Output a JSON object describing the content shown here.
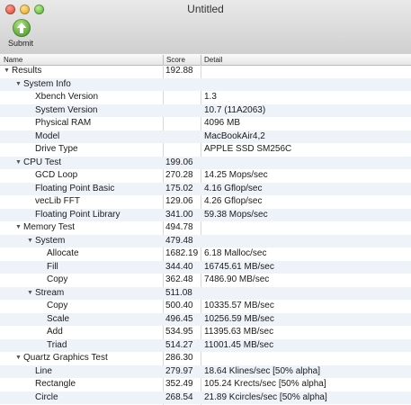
{
  "window": {
    "title": "Untitled"
  },
  "toolbar": {
    "submit_label": "Submit"
  },
  "columns": {
    "name": "Name",
    "score": "Score",
    "detail": "Detail"
  },
  "rows": [
    {
      "name": "Results",
      "score": "192.88",
      "detail": "",
      "level": 0,
      "expandable": true
    },
    {
      "name": "System Info",
      "score": "",
      "detail": "",
      "level": 1,
      "expandable": true
    },
    {
      "name": "Xbench Version",
      "score": "",
      "detail": "1.3",
      "level": 2,
      "expandable": false
    },
    {
      "name": "System Version",
      "score": "",
      "detail": "10.7 (11A2063)",
      "level": 2,
      "expandable": false
    },
    {
      "name": "Physical RAM",
      "score": "",
      "detail": "4096 MB",
      "level": 2,
      "expandable": false
    },
    {
      "name": "Model",
      "score": "",
      "detail": "MacBookAir4,2",
      "level": 2,
      "expandable": false
    },
    {
      "name": "Drive Type",
      "score": "",
      "detail": "APPLE SSD SM256C",
      "level": 2,
      "expandable": false
    },
    {
      "name": "CPU Test",
      "score": "199.06",
      "detail": "",
      "level": 1,
      "expandable": true
    },
    {
      "name": "GCD Loop",
      "score": "270.28",
      "detail": "14.25 Mops/sec",
      "level": 2,
      "expandable": false
    },
    {
      "name": "Floating Point Basic",
      "score": "175.02",
      "detail": "4.16 Gflop/sec",
      "level": 2,
      "expandable": false
    },
    {
      "name": "vecLib FFT",
      "score": "129.06",
      "detail": "4.26 Gflop/sec",
      "level": 2,
      "expandable": false
    },
    {
      "name": "Floating Point Library",
      "score": "341.00",
      "detail": "59.38 Mops/sec",
      "level": 2,
      "expandable": false
    },
    {
      "name": "Memory Test",
      "score": "494.78",
      "detail": "",
      "level": 1,
      "expandable": true
    },
    {
      "name": "System",
      "score": "479.48",
      "detail": "",
      "level": 2,
      "expandable": true
    },
    {
      "name": "Allocate",
      "score": "1682.19",
      "detail": "6.18 Malloc/sec",
      "level": 3,
      "expandable": false
    },
    {
      "name": "Fill",
      "score": "344.40",
      "detail": "16745.61 MB/sec",
      "level": 3,
      "expandable": false
    },
    {
      "name": "Copy",
      "score": "362.48",
      "detail": "7486.90 MB/sec",
      "level": 3,
      "expandable": false
    },
    {
      "name": "Stream",
      "score": "511.08",
      "detail": "",
      "level": 2,
      "expandable": true
    },
    {
      "name": "Copy",
      "score": "500.40",
      "detail": "10335.57 MB/sec",
      "level": 3,
      "expandable": false
    },
    {
      "name": "Scale",
      "score": "496.45",
      "detail": "10256.59 MB/sec",
      "level": 3,
      "expandable": false
    },
    {
      "name": "Add",
      "score": "534.95",
      "detail": "11395.63 MB/sec",
      "level": 3,
      "expandable": false
    },
    {
      "name": "Triad",
      "score": "514.27",
      "detail": "11001.45 MB/sec",
      "level": 3,
      "expandable": false
    },
    {
      "name": "Quartz Graphics Test",
      "score": "286.30",
      "detail": "",
      "level": 1,
      "expandable": true
    },
    {
      "name": "Line",
      "score": "279.97",
      "detail": "18.64 Klines/sec [50% alpha]",
      "level": 2,
      "expandable": false
    },
    {
      "name": "Rectangle",
      "score": "352.49",
      "detail": "105.24 Krects/sec [50% alpha]",
      "level": 2,
      "expandable": false
    },
    {
      "name": "Circle",
      "score": "268.54",
      "detail": "21.89 Kcircles/sec [50% alpha]",
      "level": 2,
      "expandable": false
    }
  ]
}
